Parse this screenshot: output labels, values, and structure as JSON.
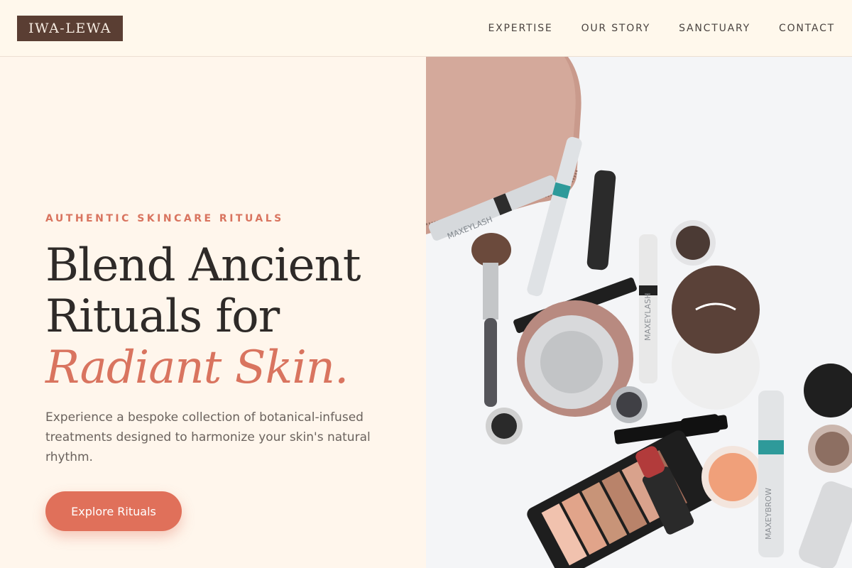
{
  "brand": {
    "logo_text": "IWA-LEWA"
  },
  "nav": {
    "items": [
      {
        "label": "EXPERTISE"
      },
      {
        "label": "OUR STORY"
      },
      {
        "label": "SANCTUARY"
      },
      {
        "label": "CONTACT"
      }
    ]
  },
  "hero": {
    "eyebrow": "AUTHENTIC SKINCARE RITUALS",
    "headline_line1": "Blend Ancient",
    "headline_line2": "Rituals for",
    "headline_accent": "Radiant Skin.",
    "description": "Experience a bespoke collection of botanical-infused treatments designed to harmonize your skin's natural rhythm.",
    "cta_label": "Explore Rituals"
  },
  "image": {
    "subject": "makeup-flatlay",
    "product_text_1": "MAXEYLASH",
    "product_text_2": "MAXEYLASH",
    "product_text_3": "MAXEYBROW"
  },
  "colors": {
    "accent": "#e0705a",
    "logo_bg": "#5a3e33",
    "page_bg": "#fff6ec"
  }
}
